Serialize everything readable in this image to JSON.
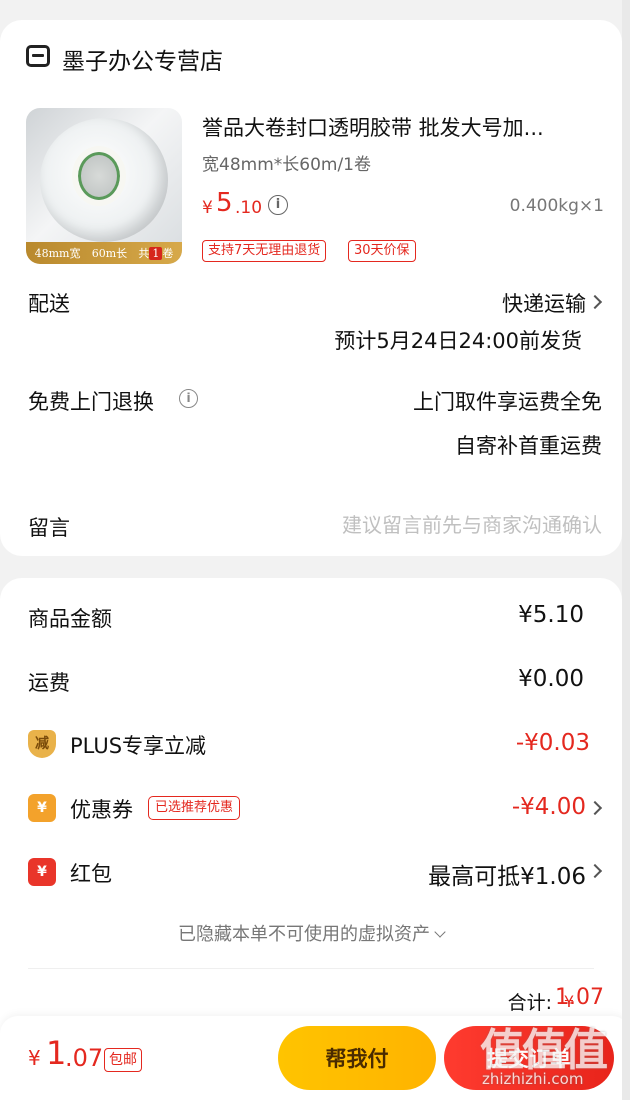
{
  "store": {
    "name": "墨子办公专营店",
    "icon": "store-icon"
  },
  "product": {
    "title": "誉品大卷封口透明胶带 批发大号加...",
    "spec": "宽48mm*长60m/1卷",
    "price_currency": "¥",
    "price_int": "5",
    "price_dec": ".10",
    "weight_qty": "0.400kg×1",
    "image_banner": {
      "width": "48mm宽",
      "length": "60m长",
      "count_prefix": "共",
      "count": "1",
      "unit": "卷"
    },
    "tags": [
      "支持7天无理由退货",
      "30天价保"
    ]
  },
  "delivery": {
    "label": "配送",
    "method": "快递运输",
    "eta": "预计5月24日24:00前发货"
  },
  "returns": {
    "label": "免费上门退换",
    "desc_line1": "上门取件享运费全免",
    "desc_line2": "自寄补首重运费"
  },
  "note": {
    "label": "留言",
    "placeholder": "建议留言前先与商家沟通确认"
  },
  "summary": {
    "goods_amount_label": "商品金额",
    "goods_amount_value": "¥5.10",
    "shipping_label": "运费",
    "shipping_value": "¥0.00",
    "plus_icon_text": "减",
    "plus_label": "PLUS专享立减",
    "plus_value": "-¥0.03",
    "coupon_icon_text": "¥",
    "coupon_label": "优惠券",
    "coupon_tag": "已选推荐优惠",
    "coupon_value": "-¥4.00",
    "redpack_icon_text": "¥",
    "redpack_label": "红包",
    "redpack_value": "最高可抵¥1.06",
    "hidden_assets": "已隐藏本单不可使用的虚拟资产",
    "total_label": "合计:",
    "total_currency": "¥",
    "total_value": "1.07"
  },
  "bottom_bar": {
    "currency": "¥",
    "amount_int": "1",
    "amount_dec": ".07",
    "free_ship_tag": "包邮",
    "help_pay_label": "帮我付",
    "submit_label": "提交订单"
  },
  "watermark": {
    "big": "值值值",
    "small": "zhizhizhi.com"
  },
  "colors": {
    "accent_red": "#e4281f",
    "help_pay_yellow": "#ffc400"
  }
}
